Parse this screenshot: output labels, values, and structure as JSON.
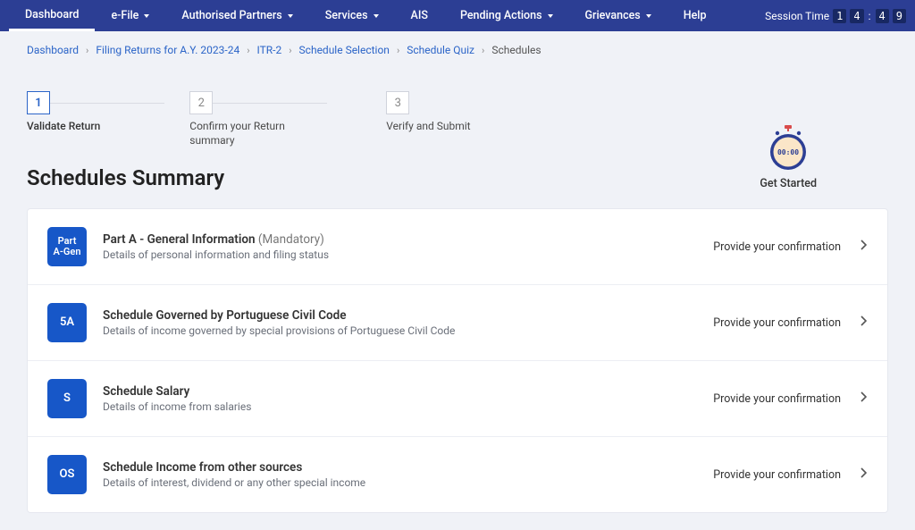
{
  "nav": {
    "items": [
      {
        "label": "Dashboard",
        "has_submenu": false,
        "active": true
      },
      {
        "label": "e-File",
        "has_submenu": true
      },
      {
        "label": "Authorised Partners",
        "has_submenu": true
      },
      {
        "label": "Services",
        "has_submenu": true
      },
      {
        "label": "AIS",
        "has_submenu": false
      },
      {
        "label": "Pending Actions",
        "has_submenu": true
      },
      {
        "label": "Grievances",
        "has_submenu": true
      },
      {
        "label": "Help",
        "has_submenu": false
      }
    ],
    "session_label": "Session Time",
    "session_digits": [
      "1",
      "4",
      "4",
      "9"
    ]
  },
  "breadcrumb": {
    "items": [
      {
        "label": "Dashboard",
        "link": true
      },
      {
        "label": "Filing Returns for A.Y. 2023-24",
        "link": true
      },
      {
        "label": "ITR-2",
        "link": true
      },
      {
        "label": "Schedule Selection",
        "link": true
      },
      {
        "label": "Schedule Quiz",
        "link": true
      },
      {
        "label": "Schedules",
        "link": false
      }
    ]
  },
  "steps": [
    {
      "num": "1",
      "label": "Validate Return",
      "active": true
    },
    {
      "num": "2",
      "label": "Confirm your Return summary",
      "active": false
    },
    {
      "num": "3",
      "label": "Verify and Submit",
      "active": false
    }
  ],
  "page_title": "Schedules Summary",
  "timer": {
    "display": "00:00",
    "caption": "Get Started"
  },
  "schedules": [
    {
      "badge_line1": "Part",
      "badge_line2": "A-Gen",
      "title": "Part A - General Information",
      "mandatory": "(Mandatory)",
      "desc": "Details of personal information and filing status",
      "status": "Provide your confirmation"
    },
    {
      "badge_line1": "5A",
      "badge_line2": "",
      "title": "Schedule Governed by Portuguese Civil Code",
      "mandatory": "",
      "desc": "Details of income governed by special provisions of Portuguese Civil Code",
      "status": "Provide your confirmation"
    },
    {
      "badge_line1": "S",
      "badge_line2": "",
      "title": "Schedule Salary",
      "mandatory": "",
      "desc": "Details of income from salaries",
      "status": "Provide your confirmation"
    },
    {
      "badge_line1": "OS",
      "badge_line2": "",
      "title": "Schedule Income from other sources",
      "mandatory": "",
      "desc": "Details of interest, dividend or any other special income",
      "status": "Provide your confirmation"
    }
  ]
}
